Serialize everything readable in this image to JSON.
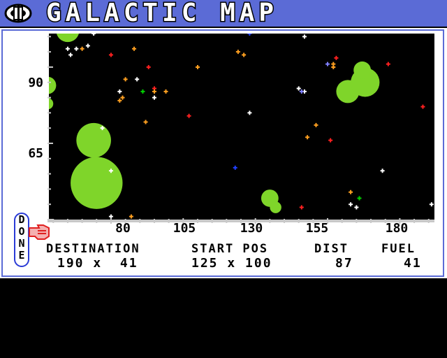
{
  "title": "GALACTIC MAP",
  "colors": {
    "title_bar": "#5b6bd6",
    "nebula": "#7fd52a",
    "map_bg": "#000000"
  },
  "icons": {
    "title": "ring-logo-icon",
    "done_pointer": "pointing-hand-icon"
  },
  "map": {
    "x_range": [
      58,
      192
    ],
    "y_range": [
      101,
      40
    ],
    "x_ticks": [
      "80",
      "105",
      "130",
      "155",
      "180"
    ],
    "y_ticks": [
      "90",
      "65"
    ],
    "stars": [
      {
        "x": 74,
        "y": 101,
        "c": "#ffffff"
      },
      {
        "x": 65,
        "y": 96,
        "c": "#ffffff"
      },
      {
        "x": 68,
        "y": 96,
        "c": "#ffffff"
      },
      {
        "x": 70,
        "y": 96,
        "c": "#ffa020"
      },
      {
        "x": 72,
        "y": 97,
        "c": "#ffffff"
      },
      {
        "x": 66,
        "y": 94,
        "c": "#ffffff"
      },
      {
        "x": 80,
        "y": 94,
        "c": "#ff2020"
      },
      {
        "x": 88,
        "y": 96,
        "c": "#ffa020"
      },
      {
        "x": 124,
        "y": 95,
        "c": "#ffa020"
      },
      {
        "x": 126,
        "y": 94,
        "c": "#ffa020"
      },
      {
        "x": 147,
        "y": 100,
        "c": "#ffffff"
      },
      {
        "x": 128,
        "y": 101,
        "c": "#2040ff"
      },
      {
        "x": 158,
        "y": 93,
        "c": "#ff2020"
      },
      {
        "x": 157,
        "y": 91,
        "c": "#ffa020"
      },
      {
        "x": 155,
        "y": 91,
        "c": "#8080ff"
      },
      {
        "x": 176,
        "y": 91,
        "c": "#ff2020"
      },
      {
        "x": 157,
        "y": 90,
        "c": "#ffa020"
      },
      {
        "x": 93,
        "y": 90,
        "c": "#ff2020"
      },
      {
        "x": 110,
        "y": 90,
        "c": "#ffa020"
      },
      {
        "x": 85,
        "y": 86,
        "c": "#ffa020"
      },
      {
        "x": 89,
        "y": 86,
        "c": "#ffffff"
      },
      {
        "x": 95,
        "y": 83,
        "c": "#ff2020"
      },
      {
        "x": 91,
        "y": 82,
        "c": "#00d000"
      },
      {
        "x": 83,
        "y": 82,
        "c": "#ffffff"
      },
      {
        "x": 95,
        "y": 82,
        "c": "#ffa020"
      },
      {
        "x": 99,
        "y": 82,
        "c": "#ffa020"
      },
      {
        "x": 95,
        "y": 80,
        "c": "#ffffff"
      },
      {
        "x": 84,
        "y": 80,
        "c": "#ffa020"
      },
      {
        "x": 83,
        "y": 79,
        "c": "#ffa020"
      },
      {
        "x": 145,
        "y": 83,
        "c": "#ffffff"
      },
      {
        "x": 147,
        "y": 82,
        "c": "#ffffff"
      },
      {
        "x": 146,
        "y": 82,
        "c": "#8080ff"
      },
      {
        "x": 188,
        "y": 77,
        "c": "#ff2020"
      },
      {
        "x": 128,
        "y": 75,
        "c": "#ffffff"
      },
      {
        "x": 107,
        "y": 74,
        "c": "#ff2020"
      },
      {
        "x": 92,
        "y": 72,
        "c": "#ffa020"
      },
      {
        "x": 77,
        "y": 70,
        "c": "#ffffff"
      },
      {
        "x": 151,
        "y": 71,
        "c": "#ffa020"
      },
      {
        "x": 148,
        "y": 67,
        "c": "#ffa020"
      },
      {
        "x": 156,
        "y": 66,
        "c": "#ff2020"
      },
      {
        "x": 123,
        "y": 57,
        "c": "#2040ff"
      },
      {
        "x": 80,
        "y": 56,
        "c": "#ffffff"
      },
      {
        "x": 174,
        "y": 56,
        "c": "#ffffff"
      },
      {
        "x": 163,
        "y": 49,
        "c": "#ffa020"
      },
      {
        "x": 166,
        "y": 47,
        "c": "#00d000"
      },
      {
        "x": 163,
        "y": 45,
        "c": "#ffffff"
      },
      {
        "x": 165,
        "y": 44,
        "c": "#ffffff"
      },
      {
        "x": 146,
        "y": 44,
        "c": "#ff2020"
      },
      {
        "x": 191,
        "y": 45,
        "c": "#ffffff"
      },
      {
        "x": 80,
        "y": 41,
        "c": "#ffffff"
      },
      {
        "x": 87,
        "y": 41,
        "c": "#ffa020"
      }
    ],
    "nebulae": [
      {
        "x": 65,
        "y": 102,
        "r": 4
      },
      {
        "x": 58,
        "y": 84,
        "r": 3
      },
      {
        "x": 58,
        "y": 78,
        "r": 2
      },
      {
        "x": 74,
        "y": 66,
        "r": 6
      },
      {
        "x": 75,
        "y": 52,
        "r": 9
      },
      {
        "x": 135,
        "y": 47,
        "r": 3
      },
      {
        "x": 137,
        "y": 44,
        "r": 2
      },
      {
        "x": 162,
        "y": 82,
        "r": 4
      },
      {
        "x": 168,
        "y": 85,
        "r": 5
      },
      {
        "x": 167,
        "y": 89,
        "r": 3
      }
    ]
  },
  "done_label": [
    "D",
    "O",
    "N",
    "E"
  ],
  "status": {
    "destination_label": "DESTINATION",
    "destination_value": "190 x  41",
    "start_label": "START POS",
    "start_value": "125 x 100",
    "dist_label": "DIST",
    "dist_value": "87",
    "fuel_label": "FUEL",
    "fuel_value": "41"
  }
}
